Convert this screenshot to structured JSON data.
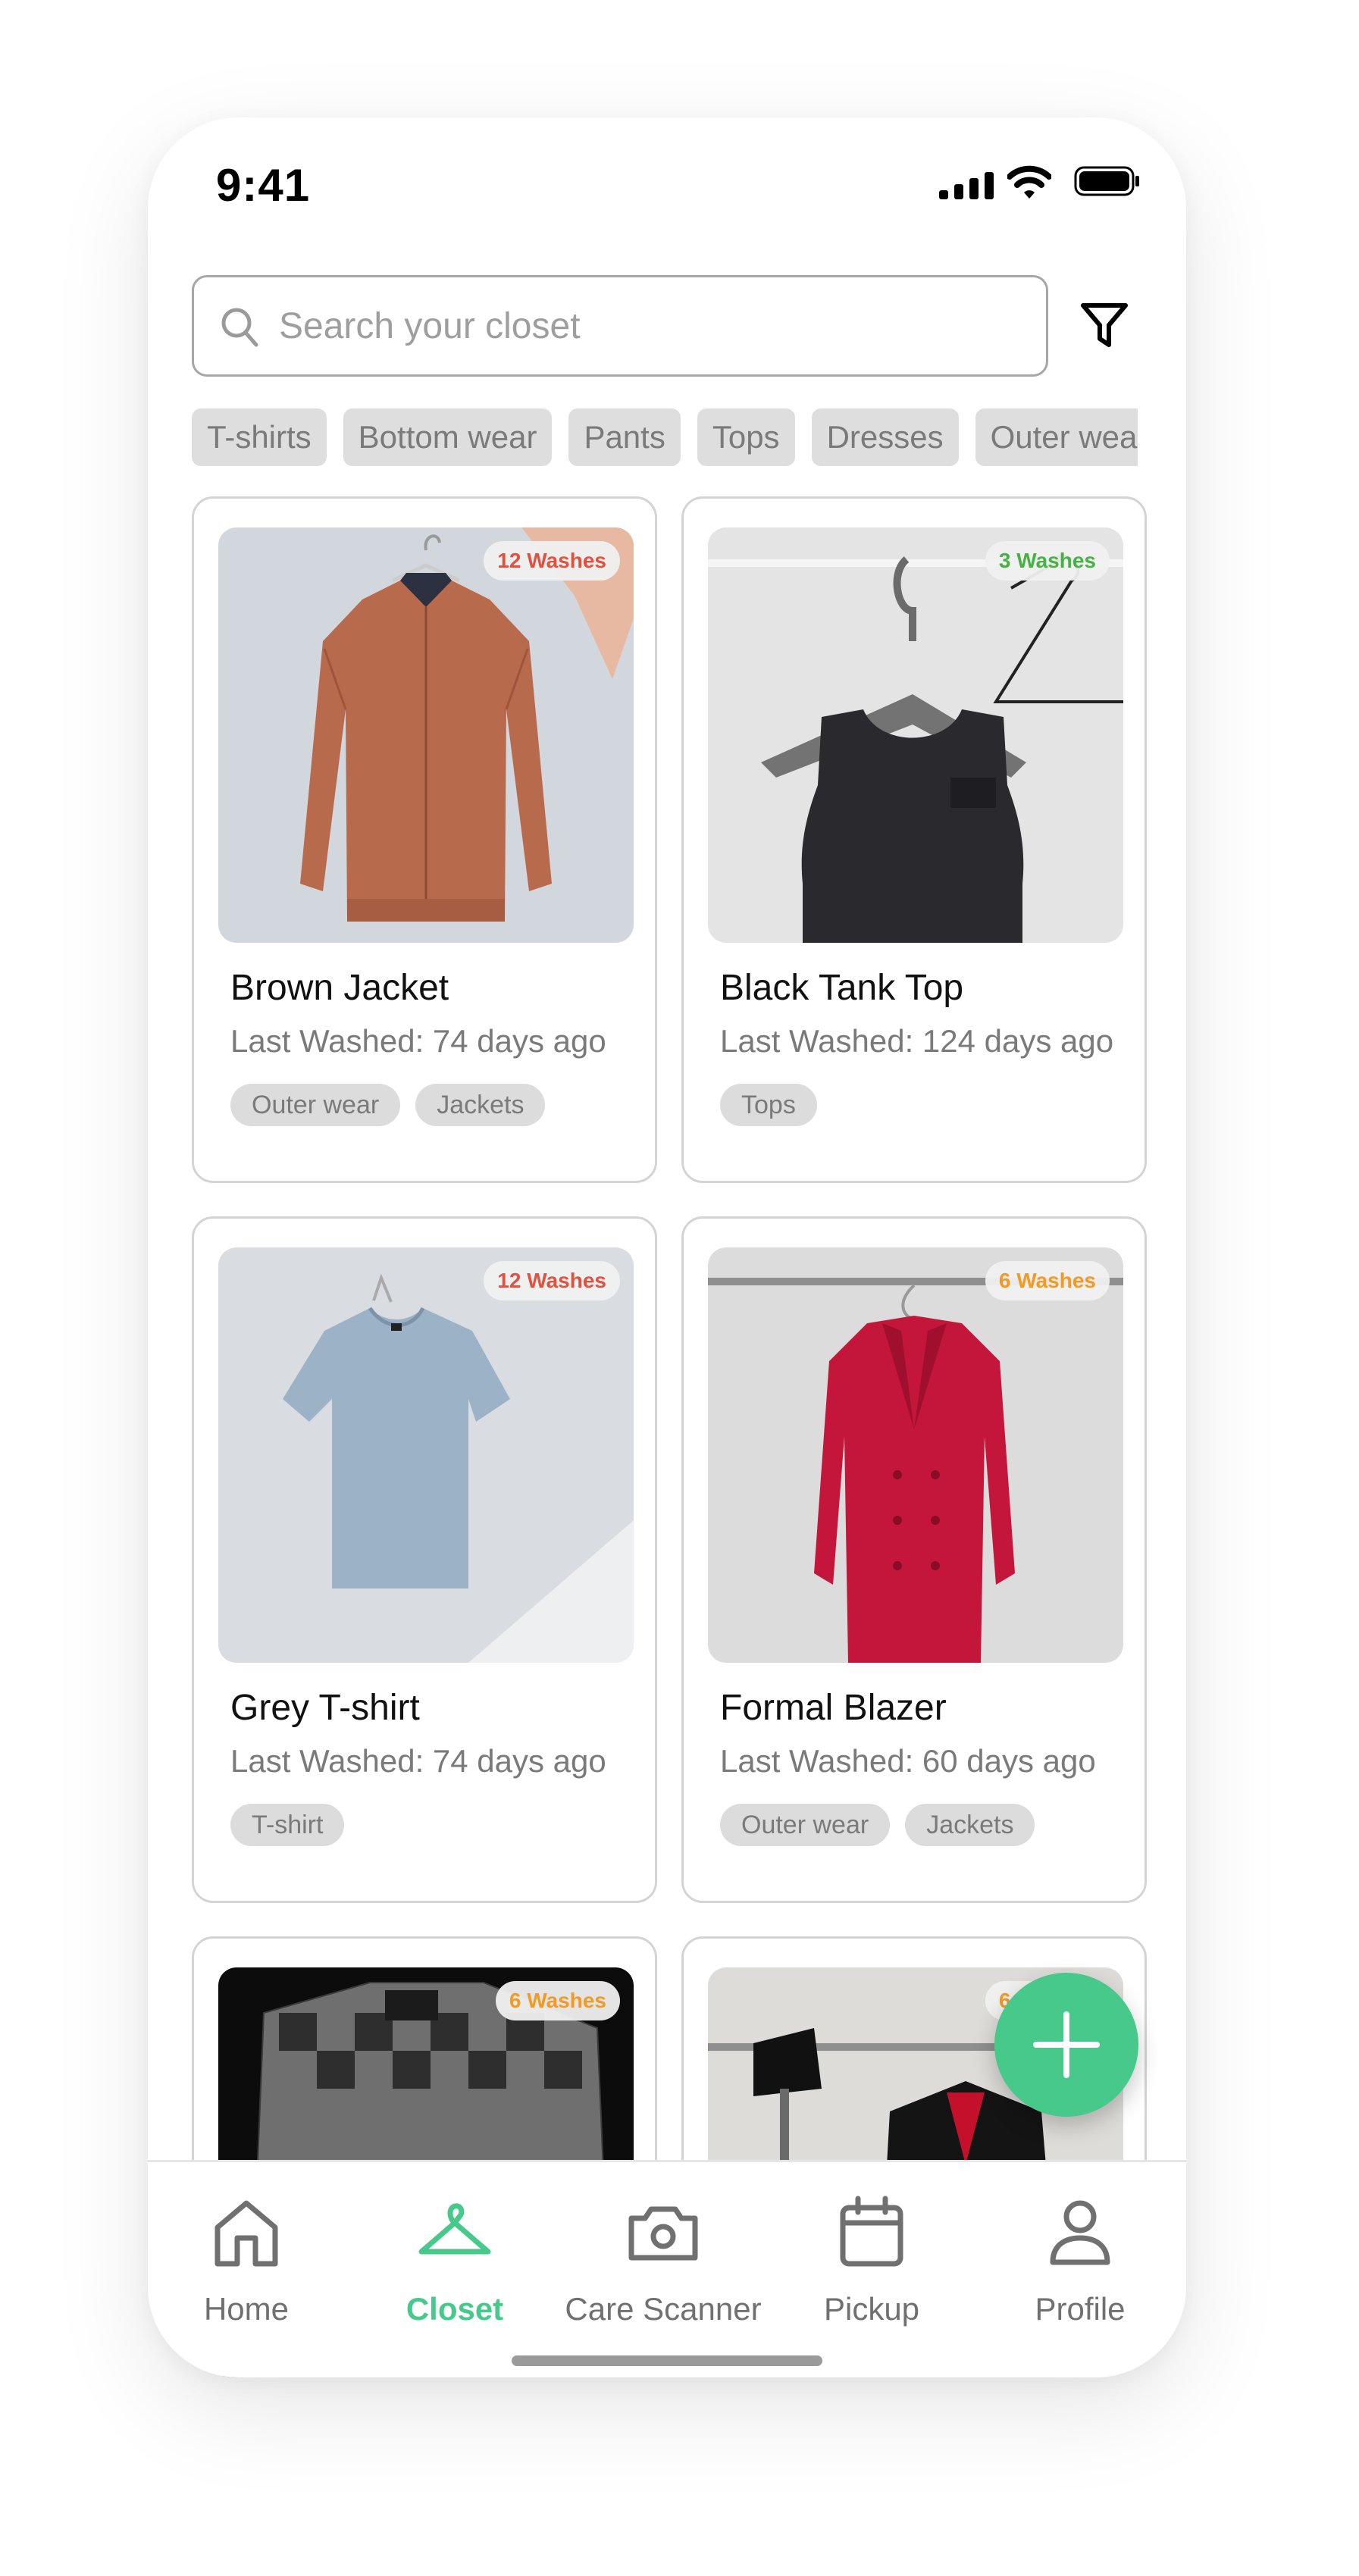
{
  "status_bar": {
    "time": "9:41"
  },
  "search": {
    "placeholder": "Search your closet"
  },
  "chips": [
    "T-shirts",
    "Bottom wear",
    "Pants",
    "Tops",
    "Dresses",
    "Outer wear"
  ],
  "items": [
    {
      "title": "Brown Jacket",
      "last_washed": "Last Washed: 74 days ago",
      "washes": "12 Washes",
      "wash_color": "#e0523f",
      "tags": [
        "Outer wear",
        "Jackets"
      ]
    },
    {
      "title": "Black Tank Top",
      "last_washed": "Last Washed: 124 days ago",
      "washes": "3 Washes",
      "wash_color": "#46b244",
      "tags": [
        "Tops"
      ]
    },
    {
      "title": "Grey T-shirt",
      "last_washed": "Last Washed: 74 days ago",
      "washes": "12 Washes",
      "wash_color": "#e0523f",
      "tags": [
        "T-shirt"
      ]
    },
    {
      "title": "Formal Blazer",
      "last_washed": "Last Washed: 60 days ago",
      "washes": "6 Washes",
      "wash_color": "#f39a22",
      "tags": [
        "Outer wear",
        "Jackets"
      ]
    },
    {
      "washes": "6 Washes",
      "wash_color": "#f39a22"
    },
    {
      "washes": "6 Washes",
      "wash_color": "#f39a22"
    }
  ],
  "nav": [
    {
      "label": "Home",
      "icon": "home-icon",
      "active": false
    },
    {
      "label": "Closet",
      "icon": "hanger-icon",
      "active": true
    },
    {
      "label": "Care Scanner",
      "icon": "camera-icon",
      "active": false
    },
    {
      "label": "Pickup",
      "icon": "calendar-icon",
      "active": false
    },
    {
      "label": "Profile",
      "icon": "user-icon",
      "active": false
    }
  ],
  "colors": {
    "accent": "#48c98c",
    "chip_bg": "#dedede",
    "border": "#d4d4d4"
  }
}
